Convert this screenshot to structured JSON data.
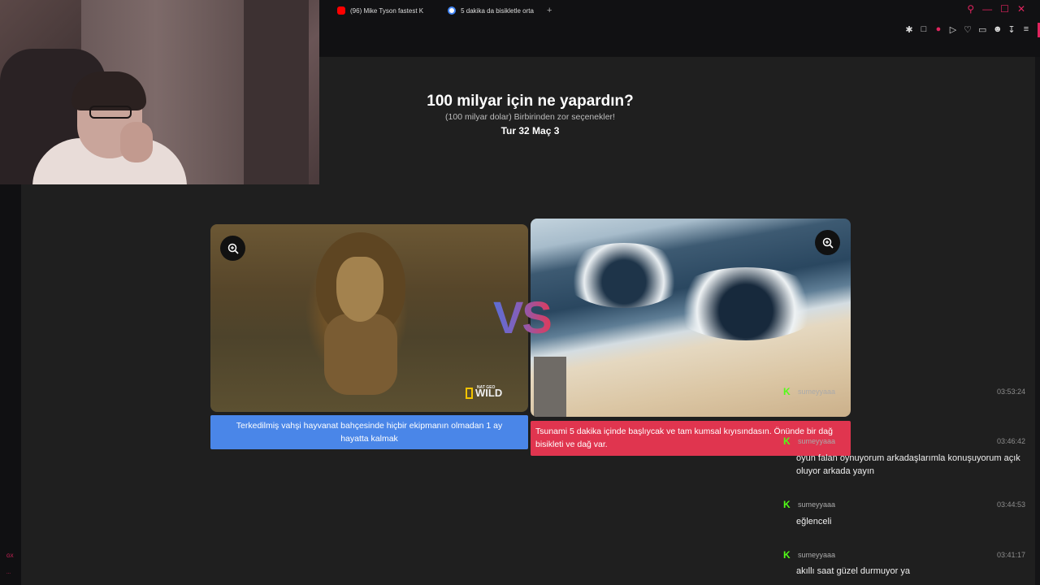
{
  "browser": {
    "tabs": [
      {
        "title": "(96) Mike Tyson fastest K",
        "favicon": "youtube-icon"
      },
      {
        "title": "5 dakika da bisikletle orta",
        "favicon": "google-icon"
      }
    ],
    "new_tab": "+",
    "window_controls": [
      "search-icon",
      "minimize-icon",
      "maximize-icon",
      "close-icon"
    ],
    "toolbar_icons": [
      "pin-icon",
      "snapshot-icon",
      "pocket-icon",
      "play-icon",
      "heart-icon",
      "extensions-icon",
      "profile-icon",
      "download-icon",
      "menu-icon"
    ],
    "sidebar_labels": [
      "GX",
      "..."
    ]
  },
  "game": {
    "title": "100 milyar için ne yapardın?",
    "subtitle": "(100 milyar dolar) Birbirinden zor seçenekler!",
    "round": "Tur 32 Maç 3",
    "vs": "VS",
    "left": {
      "caption": "Terkedilmiş vahşi hayvanat bahçesinde hiçbir ekipmanın olmadan 1 ay hayatta kalmak",
      "watermark": "WILD",
      "watermark_small": "NAT GEO",
      "color": "#4a86e8"
    },
    "right": {
      "caption": "Tsunami 5 dakika içinde başlıycak ve tam kumsal kıyısındasın. Önünde bir dağ bisikleti ve dağ var.",
      "color": "#e0354f"
    }
  },
  "chat": {
    "platform_badge": "K",
    "messages": [
      {
        "user": "sumeyyaaa",
        "time": "03:53:24",
        "text": ""
      },
      {
        "user": "sumeyyaaa",
        "time": "03:46:42",
        "text": "oyun falan oynuyorum arkadaşlarımla konuşuyorum açık oluyor arkada yayın"
      },
      {
        "user": "sumeyyaaa",
        "time": "03:44:53",
        "text": "eğlenceli"
      },
      {
        "user": "sumeyyaaa",
        "time": "03:41:17",
        "text": "akıllı saat güzel durmuyor ya"
      }
    ]
  }
}
